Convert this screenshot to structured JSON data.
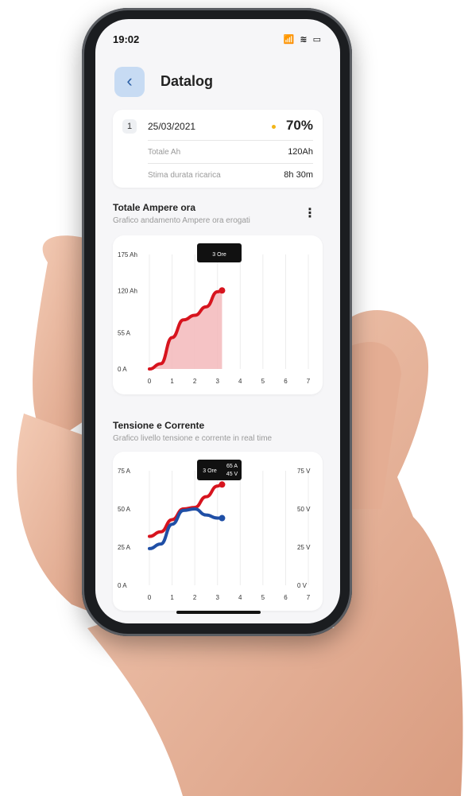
{
  "status_bar": {
    "time": "19:02",
    "icons": "📶 ≋ ▭"
  },
  "header": {
    "back_icon": "chevron-left-icon",
    "title": "Datalog"
  },
  "summary": {
    "index": "1",
    "date": "25/03/2021",
    "percent": "70%",
    "rows": [
      {
        "label": "Totale Ah",
        "value": "120Ah"
      },
      {
        "label": "Stima durata ricarica",
        "value": "8h 30m"
      }
    ]
  },
  "section1": {
    "title": "Totale Ampere ora",
    "subtitle": "Grafico andamento Ampere ora erogati",
    "more_icon": "⋮"
  },
  "section2": {
    "title": "Tensione e Corrente",
    "subtitle": "Grafico livello tensione e corrente in real time"
  },
  "colors": {
    "accent": "#c7dbf3",
    "red": "#d7141e",
    "blue": "#1f4fa6",
    "dot": "#f2b519"
  },
  "chart_data": [
    {
      "type": "area",
      "x": [
        0,
        0.5,
        1,
        1.5,
        2,
        2.5,
        3,
        3.2
      ],
      "y": [
        0,
        8,
        48,
        75,
        82,
        95,
        118,
        120
      ],
      "y_ticks": [
        "0 A",
        "55 A",
        "120 Ah",
        "175 Ah"
      ],
      "y_tick_values": [
        0,
        55,
        120,
        175
      ],
      "ylim": [
        0,
        175
      ],
      "x_ticks": [
        "0",
        "1",
        "2",
        "3",
        "4",
        "5",
        "6",
        "7"
      ],
      "xlim": [
        0,
        7
      ],
      "tooltip": "3 Ore",
      "color": "#d7141e"
    },
    {
      "type": "line",
      "x_ticks": [
        "0",
        "1",
        "2",
        "3",
        "4",
        "5",
        "6",
        "7"
      ],
      "xlim": [
        0,
        7
      ],
      "y_ticks_left": [
        "0 A",
        "25 A",
        "50 A",
        "75 A"
      ],
      "y_ticks_left_values": [
        0,
        25,
        50,
        75
      ],
      "y_ticks_right": [
        "0 V",
        "25 V",
        "50 V",
        "75 V"
      ],
      "ylim": [
        0,
        75
      ],
      "series": [
        {
          "color": "#d7141e",
          "x": [
            0,
            0.5,
            1,
            1.5,
            2,
            2.5,
            3,
            3.2
          ],
          "y": [
            32,
            35,
            43,
            50,
            51,
            58,
            65,
            66
          ]
        },
        {
          "color": "#1f4fa6",
          "x": [
            0,
            0.5,
            1,
            1.5,
            2,
            2.5,
            3,
            3.2
          ],
          "y": [
            24,
            27,
            40,
            49,
            50,
            46,
            44,
            44
          ]
        }
      ],
      "tooltip": {
        "label": "3 Ore",
        "line1": "65 A",
        "line2": "45 V"
      }
    }
  ]
}
